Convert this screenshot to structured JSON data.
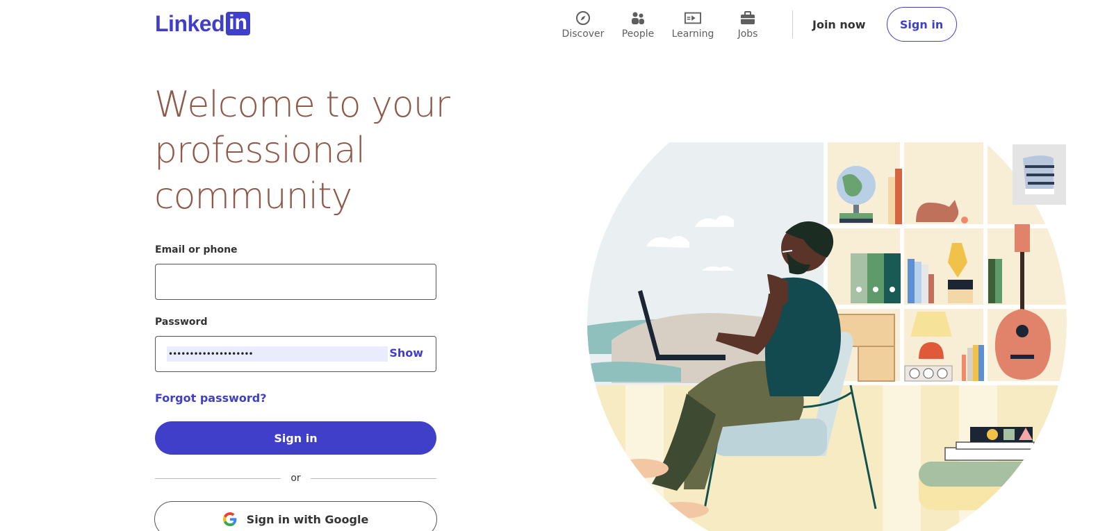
{
  "brand": {
    "logo_text": "Linked",
    "logo_box": "in",
    "accent": "#3f3fc9"
  },
  "nav": {
    "items": [
      {
        "label": "Discover",
        "icon": "compass-icon"
      },
      {
        "label": "People",
        "icon": "people-icon"
      },
      {
        "label": "Learning",
        "icon": "learning-icon"
      },
      {
        "label": "Jobs",
        "icon": "briefcase-icon"
      }
    ],
    "join_label": "Join now",
    "signin_label": "Sign in"
  },
  "hero": {
    "headline": "Welcome to your professional community"
  },
  "form": {
    "email_label": "Email or phone",
    "email_value": "",
    "password_label": "Password",
    "password_value": "••••••••••••••••••••",
    "show_label": "Show",
    "forgot_label": "Forgot password?",
    "signin_label": "Sign in",
    "or_label": "or",
    "google_label": "Sign in with Google"
  }
}
